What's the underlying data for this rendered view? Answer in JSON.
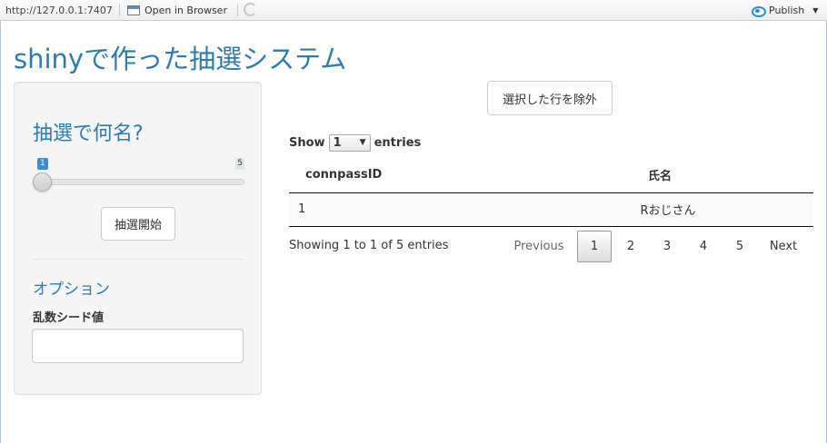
{
  "toolbar": {
    "url": "http://127.0.0.1:7407",
    "open_browser": "Open in Browser",
    "publish": "Publish"
  },
  "app": {
    "title": "shinyで作った抽選システム"
  },
  "sidebar": {
    "heading": "抽選で何名?",
    "slider": {
      "min_label": "1",
      "max_label": "5",
      "value": 1
    },
    "start_button": "抽選開始",
    "options_heading": "オプション",
    "seed_label": "乱数シード値",
    "seed_value": ""
  },
  "main": {
    "exclude_button": "選択した行を除外",
    "length_menu": {
      "show": "Show",
      "selected": "1",
      "entries": "entries"
    },
    "table": {
      "headers": [
        "connpassID",
        "氏名"
      ],
      "rows": [
        [
          "1",
          "Rおじさん"
        ]
      ]
    },
    "info": "Showing 1 to 1 of 5 entries",
    "pagination": {
      "previous": "Previous",
      "pages": [
        "1",
        "2",
        "3",
        "4",
        "5"
      ],
      "active": "1",
      "next": "Next"
    }
  }
}
